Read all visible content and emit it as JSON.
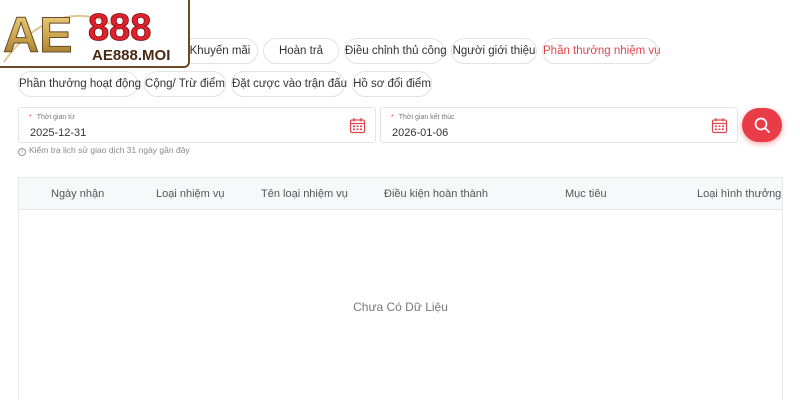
{
  "logo": {
    "text_main": "AE888",
    "text_sub": "AE888.MOI"
  },
  "tabs_row1": [
    {
      "label": "Khuyến mãi",
      "active": false
    },
    {
      "label": "Hoàn trả",
      "active": false
    },
    {
      "label": "Điều chỉnh thủ công",
      "active": false
    },
    {
      "label": "Người giới thiệu",
      "active": false
    },
    {
      "label": "Phần thưởng nhiệm vụ",
      "active": true
    }
  ],
  "tabs_row2": [
    {
      "label": "Phần thưởng hoạt động",
      "active": false
    },
    {
      "label": "Cộng/ Trừ điểm",
      "active": false
    },
    {
      "label": "Đặt cược vào trận đấu",
      "active": false
    },
    {
      "label": "Hồ sơ đổi điểm",
      "active": false
    }
  ],
  "filters": {
    "from": {
      "label": "Thời gian từ",
      "value": "2025-12-31"
    },
    "to": {
      "label": "Thời gian kết thúc",
      "value": "2026-01-06"
    },
    "required_mark": "*",
    "hint": "Kiểm tra lịch sử giao dịch 31 ngày gần đây",
    "info_glyph": "i"
  },
  "table": {
    "columns": [
      "Ngày nhận",
      "Loại nhiệm vụ",
      "Tên loại nhiệm vụ",
      "Điều kiện hoàn thành",
      "Mục tiêu",
      "Loại hình thưởng"
    ],
    "empty_text": "Chưa Có Dữ Liệu"
  },
  "colors": {
    "accent": "#e0454b",
    "search_button": "#ea3b48",
    "logo_gold": "#c9a24a",
    "logo_red": "#e0202a"
  },
  "icons": {
    "calendar": "calendar-icon",
    "search": "search-icon",
    "info": "info-icon"
  }
}
